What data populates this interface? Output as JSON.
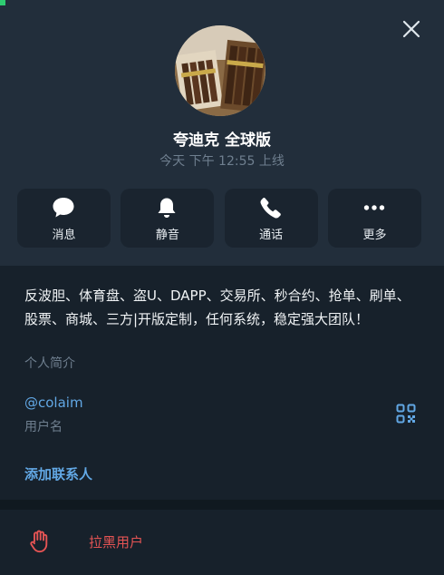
{
  "profile": {
    "name": "夸迪克 全球版",
    "last_seen": "今天 下午 12:55 上线"
  },
  "actions": [
    {
      "label": "消息",
      "icon": "chat-bubble-icon"
    },
    {
      "label": "静音",
      "icon": "bell-icon"
    },
    {
      "label": "通话",
      "icon": "phone-icon"
    },
    {
      "label": "更多",
      "icon": "more-dots-icon"
    }
  ],
  "info": {
    "bio": "反波胆、体育盘、盗U、DAPP、交易所、秒合约、抢单、刷单、股票、商城、三方|开版定制，任何系统，稳定强大团队！",
    "bio_label": "个人简介",
    "username": "@colaim",
    "username_label": "用户名",
    "add_contact": "添加联系人"
  },
  "block": {
    "label": "拉黑用户"
  },
  "colors": {
    "header_bg": "#222e3b",
    "body_bg": "#17212b",
    "accent": "#62a8e5",
    "danger": "#e55454",
    "muted": "#6f7f8f"
  }
}
